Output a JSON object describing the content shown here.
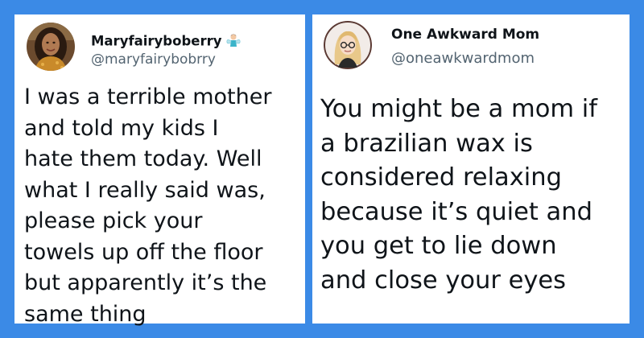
{
  "tweets": [
    {
      "name": "Maryfairyboberry",
      "handle": "@maryfairybobrry",
      "badge_icon": "fairy-emoji",
      "text": "I was a terrible mother\nand told my kids I\nhate them today. Well\nwhat I really said was,\nplease pick your\ntowels up off the floor\nbut apparently it’s the\nsame thing"
    },
    {
      "name": "One Awkward Mom",
      "handle": "@oneawkwardmom",
      "text": "You might be a mom if\na brazilian wax is\nconsidered relaxing\nbecause it’s quiet and\nyou get to lie down\nand close your eyes"
    }
  ],
  "colors": {
    "background": "#3b8ae6",
    "card": "#ffffff",
    "text": "#0f1419",
    "handle": "#536471"
  }
}
